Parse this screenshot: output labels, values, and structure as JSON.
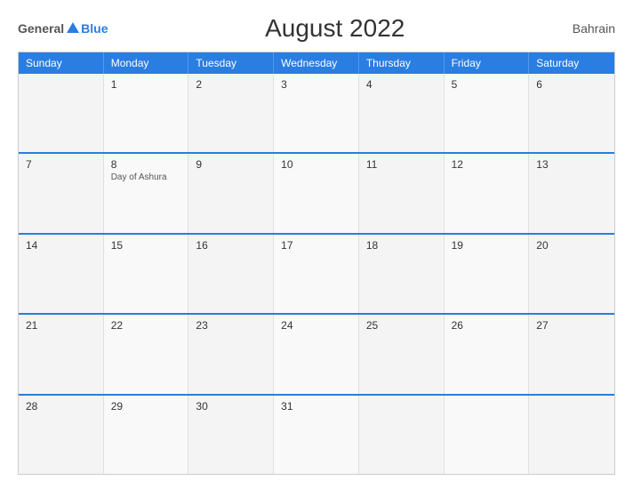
{
  "header": {
    "logo": {
      "general": "General",
      "blue": "Blue"
    },
    "title": "August 2022",
    "country": "Bahrain"
  },
  "days_of_week": [
    "Sunday",
    "Monday",
    "Tuesday",
    "Wednesday",
    "Thursday",
    "Friday",
    "Saturday"
  ],
  "weeks": [
    [
      {
        "day": "",
        "empty": true
      },
      {
        "day": "1"
      },
      {
        "day": "2"
      },
      {
        "day": "3"
      },
      {
        "day": "4"
      },
      {
        "day": "5"
      },
      {
        "day": "6"
      }
    ],
    [
      {
        "day": "7"
      },
      {
        "day": "8",
        "holiday": "Day of Ashura"
      },
      {
        "day": "9"
      },
      {
        "day": "10"
      },
      {
        "day": "11"
      },
      {
        "day": "12"
      },
      {
        "day": "13"
      }
    ],
    [
      {
        "day": "14"
      },
      {
        "day": "15"
      },
      {
        "day": "16"
      },
      {
        "day": "17"
      },
      {
        "day": "18"
      },
      {
        "day": "19"
      },
      {
        "day": "20"
      }
    ],
    [
      {
        "day": "21"
      },
      {
        "day": "22"
      },
      {
        "day": "23"
      },
      {
        "day": "24"
      },
      {
        "day": "25"
      },
      {
        "day": "26"
      },
      {
        "day": "27"
      }
    ],
    [
      {
        "day": "28"
      },
      {
        "day": "29"
      },
      {
        "day": "30"
      },
      {
        "day": "31"
      },
      {
        "day": "",
        "empty": true
      },
      {
        "day": "",
        "empty": true
      },
      {
        "day": "",
        "empty": true
      }
    ]
  ]
}
